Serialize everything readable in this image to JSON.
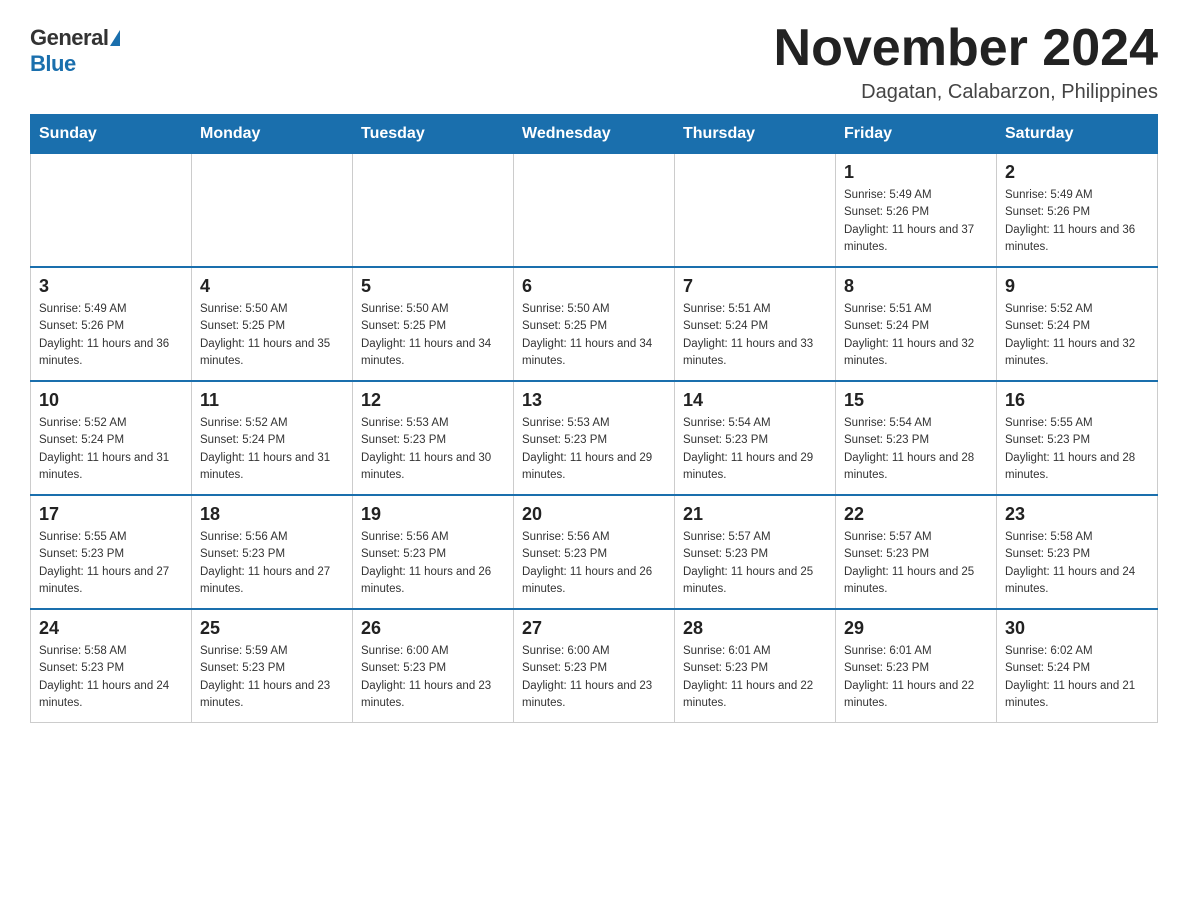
{
  "logo": {
    "general": "General",
    "blue": "Blue"
  },
  "title": "November 2024",
  "subtitle": "Dagatan, Calabarzon, Philippines",
  "days_of_week": [
    "Sunday",
    "Monday",
    "Tuesday",
    "Wednesday",
    "Thursday",
    "Friday",
    "Saturday"
  ],
  "weeks": [
    [
      {
        "day": "",
        "info": ""
      },
      {
        "day": "",
        "info": ""
      },
      {
        "day": "",
        "info": ""
      },
      {
        "day": "",
        "info": ""
      },
      {
        "day": "",
        "info": ""
      },
      {
        "day": "1",
        "info": "Sunrise: 5:49 AM\nSunset: 5:26 PM\nDaylight: 11 hours and 37 minutes."
      },
      {
        "day": "2",
        "info": "Sunrise: 5:49 AM\nSunset: 5:26 PM\nDaylight: 11 hours and 36 minutes."
      }
    ],
    [
      {
        "day": "3",
        "info": "Sunrise: 5:49 AM\nSunset: 5:26 PM\nDaylight: 11 hours and 36 minutes."
      },
      {
        "day": "4",
        "info": "Sunrise: 5:50 AM\nSunset: 5:25 PM\nDaylight: 11 hours and 35 minutes."
      },
      {
        "day": "5",
        "info": "Sunrise: 5:50 AM\nSunset: 5:25 PM\nDaylight: 11 hours and 34 minutes."
      },
      {
        "day": "6",
        "info": "Sunrise: 5:50 AM\nSunset: 5:25 PM\nDaylight: 11 hours and 34 minutes."
      },
      {
        "day": "7",
        "info": "Sunrise: 5:51 AM\nSunset: 5:24 PM\nDaylight: 11 hours and 33 minutes."
      },
      {
        "day": "8",
        "info": "Sunrise: 5:51 AM\nSunset: 5:24 PM\nDaylight: 11 hours and 32 minutes."
      },
      {
        "day": "9",
        "info": "Sunrise: 5:52 AM\nSunset: 5:24 PM\nDaylight: 11 hours and 32 minutes."
      }
    ],
    [
      {
        "day": "10",
        "info": "Sunrise: 5:52 AM\nSunset: 5:24 PM\nDaylight: 11 hours and 31 minutes."
      },
      {
        "day": "11",
        "info": "Sunrise: 5:52 AM\nSunset: 5:24 PM\nDaylight: 11 hours and 31 minutes."
      },
      {
        "day": "12",
        "info": "Sunrise: 5:53 AM\nSunset: 5:23 PM\nDaylight: 11 hours and 30 minutes."
      },
      {
        "day": "13",
        "info": "Sunrise: 5:53 AM\nSunset: 5:23 PM\nDaylight: 11 hours and 29 minutes."
      },
      {
        "day": "14",
        "info": "Sunrise: 5:54 AM\nSunset: 5:23 PM\nDaylight: 11 hours and 29 minutes."
      },
      {
        "day": "15",
        "info": "Sunrise: 5:54 AM\nSunset: 5:23 PM\nDaylight: 11 hours and 28 minutes."
      },
      {
        "day": "16",
        "info": "Sunrise: 5:55 AM\nSunset: 5:23 PM\nDaylight: 11 hours and 28 minutes."
      }
    ],
    [
      {
        "day": "17",
        "info": "Sunrise: 5:55 AM\nSunset: 5:23 PM\nDaylight: 11 hours and 27 minutes."
      },
      {
        "day": "18",
        "info": "Sunrise: 5:56 AM\nSunset: 5:23 PM\nDaylight: 11 hours and 27 minutes."
      },
      {
        "day": "19",
        "info": "Sunrise: 5:56 AM\nSunset: 5:23 PM\nDaylight: 11 hours and 26 minutes."
      },
      {
        "day": "20",
        "info": "Sunrise: 5:56 AM\nSunset: 5:23 PM\nDaylight: 11 hours and 26 minutes."
      },
      {
        "day": "21",
        "info": "Sunrise: 5:57 AM\nSunset: 5:23 PM\nDaylight: 11 hours and 25 minutes."
      },
      {
        "day": "22",
        "info": "Sunrise: 5:57 AM\nSunset: 5:23 PM\nDaylight: 11 hours and 25 minutes."
      },
      {
        "day": "23",
        "info": "Sunrise: 5:58 AM\nSunset: 5:23 PM\nDaylight: 11 hours and 24 minutes."
      }
    ],
    [
      {
        "day": "24",
        "info": "Sunrise: 5:58 AM\nSunset: 5:23 PM\nDaylight: 11 hours and 24 minutes."
      },
      {
        "day": "25",
        "info": "Sunrise: 5:59 AM\nSunset: 5:23 PM\nDaylight: 11 hours and 23 minutes."
      },
      {
        "day": "26",
        "info": "Sunrise: 6:00 AM\nSunset: 5:23 PM\nDaylight: 11 hours and 23 minutes."
      },
      {
        "day": "27",
        "info": "Sunrise: 6:00 AM\nSunset: 5:23 PM\nDaylight: 11 hours and 23 minutes."
      },
      {
        "day": "28",
        "info": "Sunrise: 6:01 AM\nSunset: 5:23 PM\nDaylight: 11 hours and 22 minutes."
      },
      {
        "day": "29",
        "info": "Sunrise: 6:01 AM\nSunset: 5:23 PM\nDaylight: 11 hours and 22 minutes."
      },
      {
        "day": "30",
        "info": "Sunrise: 6:02 AM\nSunset: 5:24 PM\nDaylight: 11 hours and 21 minutes."
      }
    ]
  ]
}
